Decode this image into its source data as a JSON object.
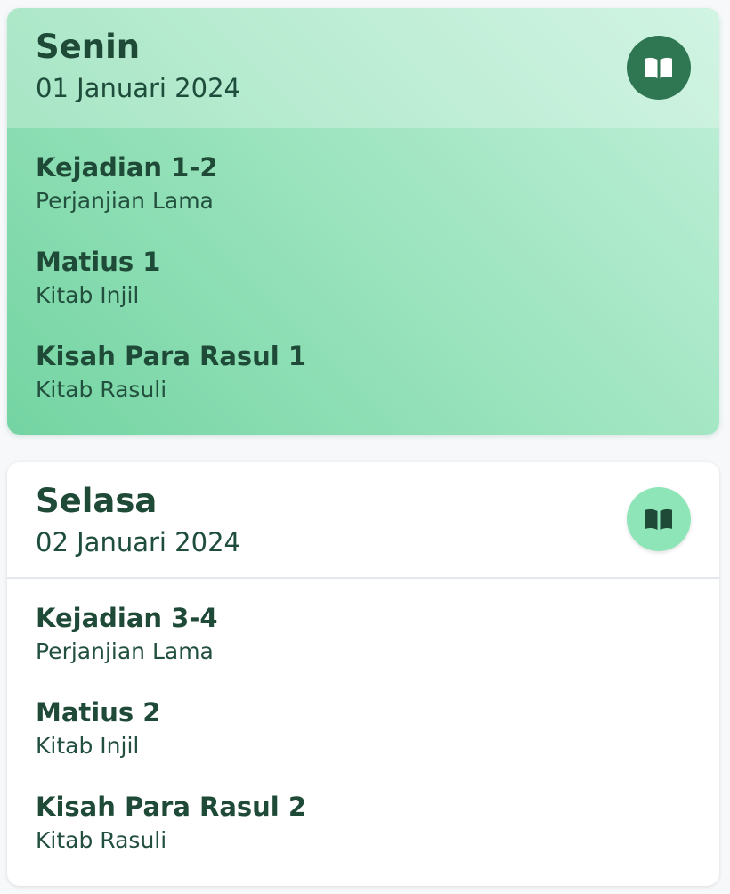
{
  "days": [
    {
      "day": "Senin",
      "date": "01 Januari 2024",
      "icon": "book-open-icon",
      "active": true,
      "readings": [
        {
          "title": "Kejadian 1-2",
          "category": "Perjanjian Lama"
        },
        {
          "title": "Matius 1",
          "category": "Kitab Injil"
        },
        {
          "title": "Kisah Para Rasul 1",
          "category": "Kitab Rasuli"
        }
      ]
    },
    {
      "day": "Selasa",
      "date": "02 Januari 2024",
      "icon": "book-open-icon",
      "active": false,
      "readings": [
        {
          "title": "Kejadian 3-4",
          "category": "Perjanjian Lama"
        },
        {
          "title": "Matius 2",
          "category": "Kitab Injil"
        },
        {
          "title": "Kisah Para Rasul 2",
          "category": "Kitab Rasuli"
        }
      ]
    }
  ],
  "colors": {
    "active_icon_bg": "#2f7653",
    "default_icon_bg": "#8ee6b8",
    "text": "#1e4a37"
  }
}
